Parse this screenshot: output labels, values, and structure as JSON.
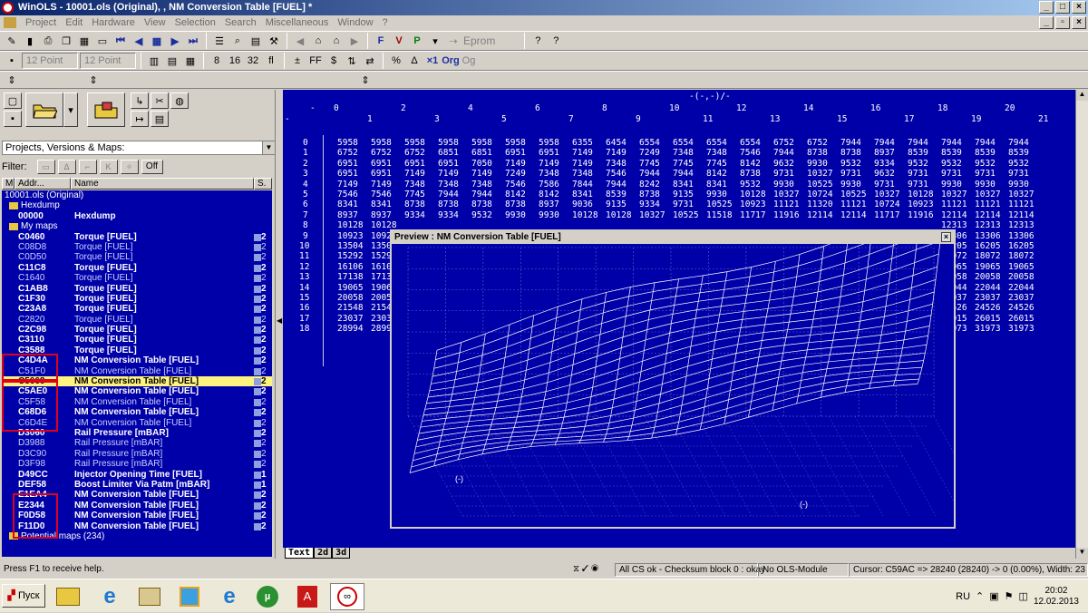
{
  "window": {
    "title": "WinOLS - 10001.ols (Original), , NM Conversion Table [FUEL] *",
    "min": "_",
    "max": "□",
    "close": "×"
  },
  "menu": [
    "Project",
    "Edit",
    "Hardware",
    "View",
    "Selection",
    "Search",
    "Miscellaneous",
    "Window",
    "?"
  ],
  "toolbar": {
    "eprom_label": "Eprom",
    "font_a": "12 Point",
    "font_b": "12 Point",
    "btn_org": "Org",
    "btn_x1": "×1",
    "btn_pct": "%"
  },
  "left": {
    "projects_combo": "Projects, Versions & Maps:",
    "filter_label": "Filter:",
    "filter_off": "Off",
    "col_m": "M",
    "col_addr": "Addr...",
    "col_name": "Name",
    "col_s": "S.",
    "project_root": "10001.ols (Original)",
    "group_hexdump": "Hexdump",
    "hexdump_row": {
      "addr": "00000",
      "name": "Hexdump"
    },
    "group_mymaps": "My maps",
    "maps": [
      {
        "addr": "C0460",
        "name": "Torque [FUEL]",
        "size": "2",
        "bold": true
      },
      {
        "addr": "C08D8",
        "name": "Torque [FUEL]",
        "size": "2",
        "bold": false
      },
      {
        "addr": "C0D50",
        "name": "Torque [FUEL]",
        "size": "2",
        "bold": false
      },
      {
        "addr": "C11C8",
        "name": "Torque [FUEL]",
        "size": "2",
        "bold": true
      },
      {
        "addr": "C1640",
        "name": "Torque [FUEL]",
        "size": "2",
        "bold": false
      },
      {
        "addr": "C1AB8",
        "name": "Torque [FUEL]",
        "size": "2",
        "bold": true
      },
      {
        "addr": "C1F30",
        "name": "Torque [FUEL]",
        "size": "2",
        "bold": true
      },
      {
        "addr": "C23A8",
        "name": "Torque [FUEL]",
        "size": "2",
        "bold": true
      },
      {
        "addr": "C2820",
        "name": "Torque [FUEL]",
        "size": "2",
        "bold": false
      },
      {
        "addr": "C2C98",
        "name": "Torque [FUEL]",
        "size": "2",
        "bold": true
      },
      {
        "addr": "C3110",
        "name": "Torque [FUEL]",
        "size": "2",
        "bold": true
      },
      {
        "addr": "C3588",
        "name": "Torque [FUEL]",
        "size": "2",
        "bold": true
      },
      {
        "addr": "C4D4A",
        "name": "NM Conversion Table [FUEL]",
        "size": "2",
        "bold": true
      },
      {
        "addr": "C51F0",
        "name": "NM Conversion Table [FUEL]",
        "size": "2",
        "bold": false
      },
      {
        "addr": "C5668",
        "name": "NM Conversion Table [FUEL]",
        "size": "2",
        "bold": true,
        "selected": true
      },
      {
        "addr": "C5AE0",
        "name": "NM Conversion Table [FUEL]",
        "size": "2",
        "bold": true
      },
      {
        "addr": "C5F58",
        "name": "NM Conversion Table [FUEL]",
        "size": "2",
        "bold": false
      },
      {
        "addr": "C68D6",
        "name": "NM Conversion Table [FUEL]",
        "size": "2",
        "bold": true
      },
      {
        "addr": "C6D4E",
        "name": "NM Conversion Table [FUEL]",
        "size": "2",
        "bold": false
      },
      {
        "addr": "D3060",
        "name": "Rail Pressure [mBAR]",
        "size": "2",
        "bold": true
      },
      {
        "addr": "D3988",
        "name": "Rail Pressure [mBAR]",
        "size": "2",
        "bold": false
      },
      {
        "addr": "D3C90",
        "name": "Rail Pressure [mBAR]",
        "size": "2",
        "bold": false
      },
      {
        "addr": "D3F98",
        "name": "Rail Pressure [mBAR]",
        "size": "2",
        "bold": false
      },
      {
        "addr": "D49CC",
        "name": "Injector Opening Time [FUEL]",
        "size": "1",
        "bold": true
      },
      {
        "addr": "DEF58",
        "name": "Boost Limiter Via Patm [mBAR]",
        "size": "1",
        "bold": true
      },
      {
        "addr": "E1EA4",
        "name": "NM Conversion Table [FUEL]",
        "size": "2",
        "bold": true
      },
      {
        "addr": "E2344",
        "name": "NM Conversion Table [FUEL]",
        "size": "2",
        "bold": true
      },
      {
        "addr": "F0D58",
        "name": "NM Conversion Table [FUEL]",
        "size": "2",
        "bold": true
      },
      {
        "addr": "F11D0",
        "name": "NM Conversion Table [FUEL]",
        "size": "2",
        "bold": true
      }
    ],
    "group_potential": "Potential maps (234)"
  },
  "grid": {
    "axis_title": "-(-,-)/-",
    "corner": "-",
    "cols_even": [
      "0",
      "2",
      "4",
      "6",
      "8",
      "10",
      "12",
      "14",
      "16",
      "18",
      "20"
    ],
    "cols_odd": [
      "1",
      "3",
      "5",
      "7",
      "9",
      "11",
      "13",
      "15",
      "17",
      "19",
      "21"
    ],
    "rows": [
      {
        "idx": "0",
        "vals": [
          "5958",
          "5958",
          "5958",
          "5958",
          "5958",
          "5958",
          "5958",
          "6355",
          "6454",
          "6554",
          "6554",
          "6554",
          "6554",
          "6752",
          "6752",
          "7944",
          "7944",
          "7944",
          "7944",
          "7944",
          "7944"
        ]
      },
      {
        "idx": "1",
        "vals": [
          "6752",
          "6752",
          "6752",
          "6851",
          "6851",
          "6951",
          "6951",
          "7149",
          "7149",
          "7249",
          "7348",
          "7348",
          "7546",
          "7944",
          "8738",
          "8738",
          "8937",
          "8539",
          "8539",
          "8539",
          "8539"
        ]
      },
      {
        "idx": "2",
        "vals": [
          "6951",
          "6951",
          "6951",
          "6951",
          "7050",
          "7149",
          "7149",
          "7149",
          "7348",
          "7745",
          "7745",
          "7745",
          "8142",
          "9632",
          "9930",
          "9532",
          "9334",
          "9532",
          "9532",
          "9532",
          "9532"
        ]
      },
      {
        "idx": "3",
        "vals": [
          "6951",
          "6951",
          "7149",
          "7149",
          "7149",
          "7249",
          "7348",
          "7348",
          "7546",
          "7944",
          "7944",
          "8142",
          "8738",
          "9731",
          "10327",
          "9731",
          "9632",
          "9731",
          "9731",
          "9731",
          "9731"
        ]
      },
      {
        "idx": "4",
        "vals": [
          "7149",
          "7149",
          "7348",
          "7348",
          "7348",
          "7546",
          "7586",
          "7844",
          "7944",
          "8242",
          "8341",
          "8341",
          "9532",
          "9930",
          "10525",
          "9930",
          "9731",
          "9731",
          "9930",
          "9930",
          "9930"
        ]
      },
      {
        "idx": "5",
        "vals": [
          "7546",
          "7546",
          "7745",
          "7944",
          "7944",
          "8142",
          "8142",
          "8341",
          "8539",
          "8738",
          "9135",
          "9930",
          "10128",
          "10327",
          "10724",
          "10525",
          "10327",
          "10128",
          "10327",
          "10327",
          "10327"
        ]
      },
      {
        "idx": "6",
        "vals": [
          "8341",
          "8341",
          "8738",
          "8738",
          "8738",
          "8738",
          "8937",
          "9036",
          "9135",
          "9334",
          "9731",
          "10525",
          "10923",
          "11121",
          "11320",
          "11121",
          "10724",
          "10923",
          "11121",
          "11121",
          "11121"
        ]
      },
      {
        "idx": "7",
        "vals": [
          "8937",
          "8937",
          "9334",
          "9334",
          "9532",
          "9930",
          "9930",
          "10128",
          "10128",
          "10327",
          "10525",
          "11518",
          "11717",
          "11916",
          "12114",
          "12114",
          "11717",
          "11916",
          "12114",
          "12114",
          "12114"
        ]
      },
      {
        "idx": "8",
        "vals": [
          "10128",
          "10128",
          "",
          "",
          "",
          "",
          "",
          "",
          "",
          "",
          "",
          "",
          "",
          "",
          "",
          "",
          "",
          "",
          "12313",
          "12313",
          "12313"
        ]
      },
      {
        "idx": "9",
        "vals": [
          "10923",
          "10923",
          "",
          "",
          "",
          "",
          "",
          "",
          "",
          "",
          "",
          "",
          "",
          "",
          "",
          "",
          "",
          "",
          "13306",
          "13306",
          "13306"
        ]
      },
      {
        "idx": "10",
        "vals": [
          "13504",
          "13504",
          "",
          "",
          "",
          "",
          "",
          "",
          "",
          "",
          "",
          "",
          "",
          "",
          "",
          "",
          "",
          "",
          "16205",
          "16205",
          "16205"
        ]
      },
      {
        "idx": "11",
        "vals": [
          "15292",
          "15292",
          "",
          "",
          "",
          "",
          "",
          "",
          "",
          "",
          "",
          "",
          "",
          "",
          "",
          "",
          "",
          "",
          "18072",
          "18072",
          "18072"
        ]
      },
      {
        "idx": "12",
        "vals": [
          "16106",
          "16106",
          "",
          "",
          "",
          "",
          "",
          "",
          "",
          "",
          "",
          "",
          "",
          "",
          "",
          "",
          "",
          "",
          "19065",
          "19065",
          "19065"
        ]
      },
      {
        "idx": "13",
        "vals": [
          "17138",
          "17138",
          "",
          "",
          "",
          "",
          "",
          "",
          "",
          "",
          "",
          "",
          "",
          "",
          "",
          "",
          "",
          "",
          "20058",
          "20058",
          "20058"
        ]
      },
      {
        "idx": "14",
        "vals": [
          "19065",
          "19065",
          "",
          "",
          "",
          "",
          "",
          "",
          "",
          "",
          "",
          "",
          "",
          "",
          "",
          "",
          "",
          "",
          "22044",
          "22044",
          "22044"
        ]
      },
      {
        "idx": "15",
        "vals": [
          "20058",
          "20058",
          "",
          "",
          "",
          "",
          "",
          "",
          "",
          "",
          "",
          "",
          "",
          "",
          "",
          "",
          "",
          "",
          "23037",
          "23037",
          "23037"
        ]
      },
      {
        "idx": "16",
        "vals": [
          "21548",
          "21548",
          "",
          "",
          "",
          "",
          "",
          "",
          "",
          "",
          "",
          "",
          "",
          "",
          "",
          "",
          "",
          "",
          "24526",
          "24526",
          "24526"
        ]
      },
      {
        "idx": "17",
        "vals": [
          "23037",
          "23037",
          "",
          "",
          "",
          "",
          "",
          "",
          "",
          "",
          "",
          "",
          "",
          "",
          "",
          "",
          "",
          "",
          "26015",
          "26015",
          "26015"
        ]
      },
      {
        "idx": "18",
        "vals": [
          "28994",
          "28994",
          "",
          "",
          "",
          "",
          "",
          "",
          "",
          "",
          "",
          "",
          "",
          "",
          "",
          "",
          "",
          "",
          "31973",
          "31973",
          "31973"
        ]
      }
    ]
  },
  "preview": {
    "title": "Preview : NM Conversion Table [FUEL]",
    "close": "×",
    "axis_x": "(-)",
    "axis_y": "(-)"
  },
  "tabs": [
    "Text",
    "2d",
    "3d"
  ],
  "status": {
    "help": "Press F1 to receive help.",
    "checksum": "All CS ok - Checksum block 0 : okay",
    "module": "No OLS-Module",
    "cursor": "Cursor: C59AC => 28240 (28240) -> 0 (0.00%), Width: 23"
  },
  "taskbar": {
    "start": "Пуск",
    "lang": "RU",
    "time": "20:02",
    "date": "12.02.2013"
  }
}
